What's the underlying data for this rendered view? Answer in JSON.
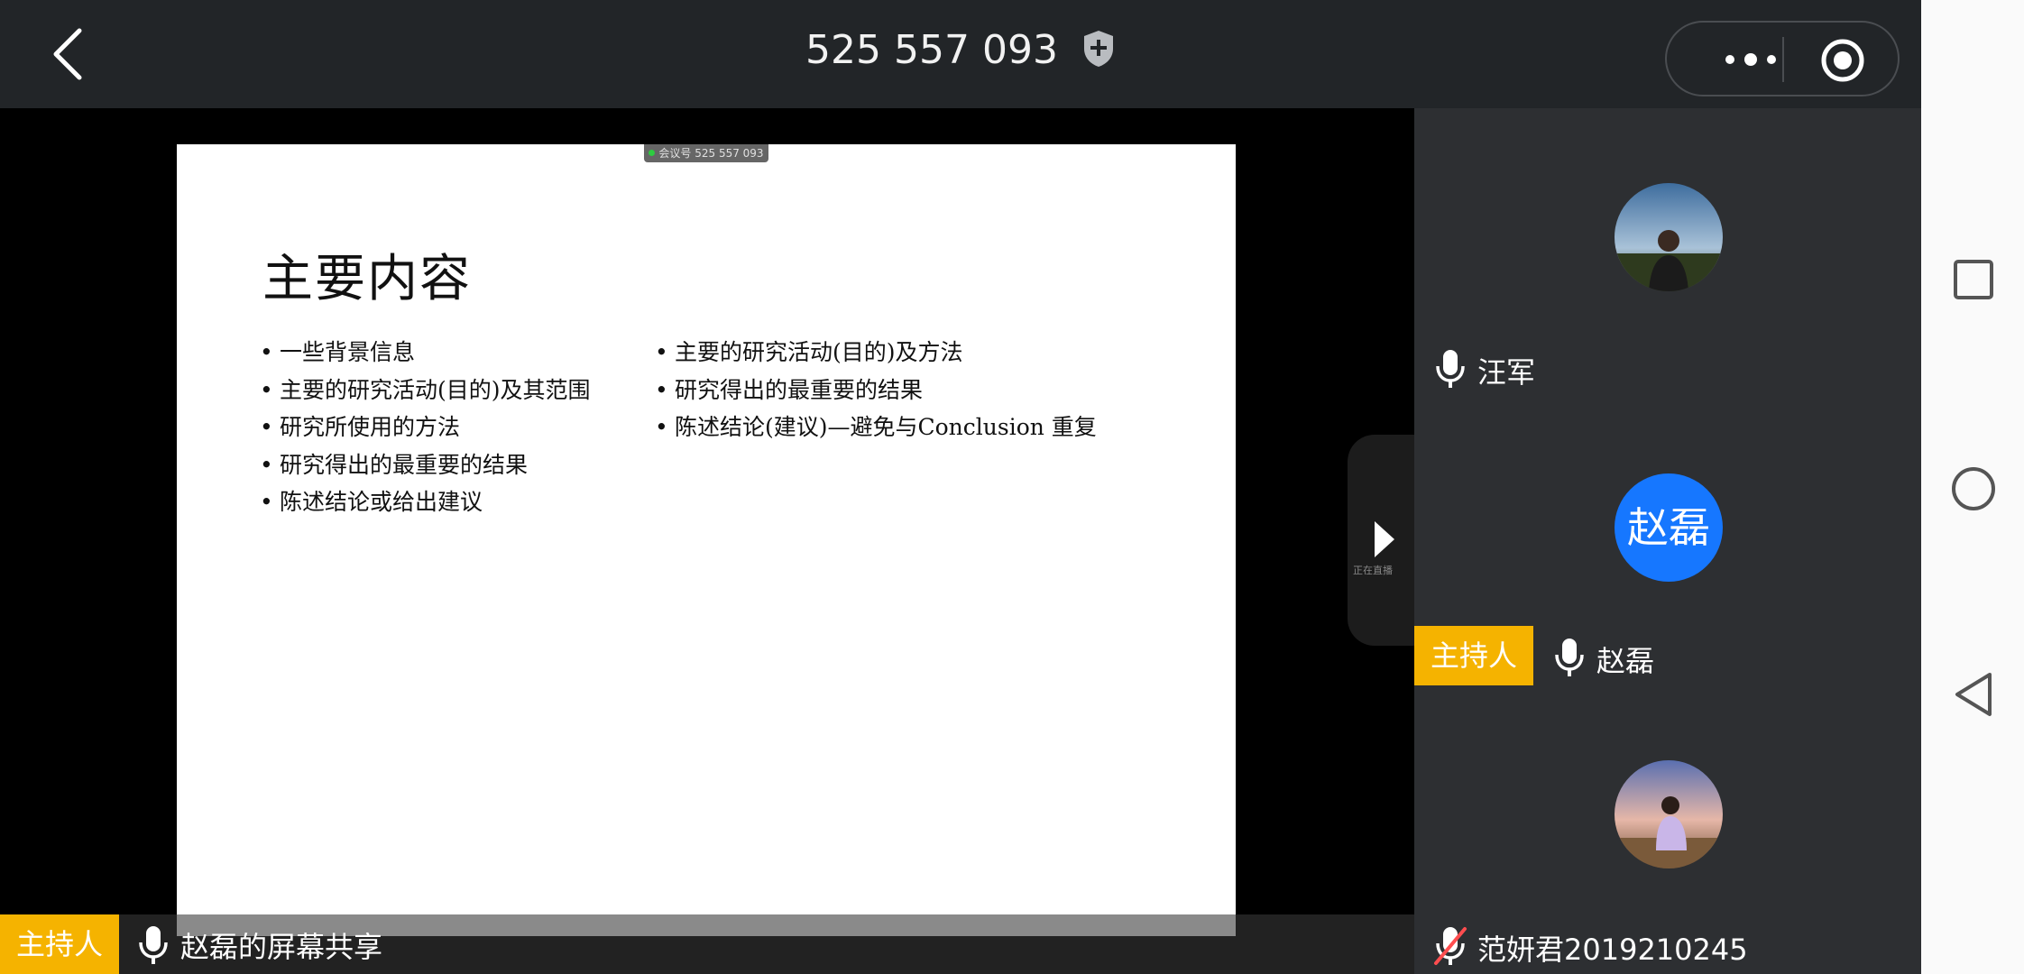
{
  "header": {
    "meeting_id": "525 557 093",
    "back_icon": "chevron-left-icon",
    "shield_icon": "shield-plus-icon",
    "more_icon": "more-dots-icon",
    "record_icon": "record-icon"
  },
  "share": {
    "overlay_tag": "会议号 525 557 093",
    "host_badge": "主持人",
    "label": "赵磊的屏幕共享",
    "live_text": "正在直播"
  },
  "slide": {
    "title": "主要内容",
    "col1": [
      "一些背景信息",
      "主要的研究活动(目的)及其范围",
      "研究所使用的方法",
      "研究得出的最重要的结果",
      "陈述结论或给出建议"
    ],
    "col2": [
      "主要的研究活动(目的)及方法",
      "研究得出的最重要的结果",
      "陈述结论(建议)—避免与Conclusion 重复"
    ]
  },
  "participants": [
    {
      "name": "汪军",
      "muted": false,
      "host": false,
      "avatar": "photo"
    },
    {
      "name": "赵磊",
      "muted": false,
      "host": true,
      "avatar_text": "赵磊",
      "host_badge": "主持人"
    },
    {
      "name": "范妍君2019210245",
      "muted": true,
      "host": false,
      "avatar": "photo"
    }
  ],
  "colors": {
    "host_badge": "#f5b300",
    "avatar_blue": "#1677ff",
    "panel_bg": "#2d2f32",
    "topbar_bg": "#222528"
  }
}
